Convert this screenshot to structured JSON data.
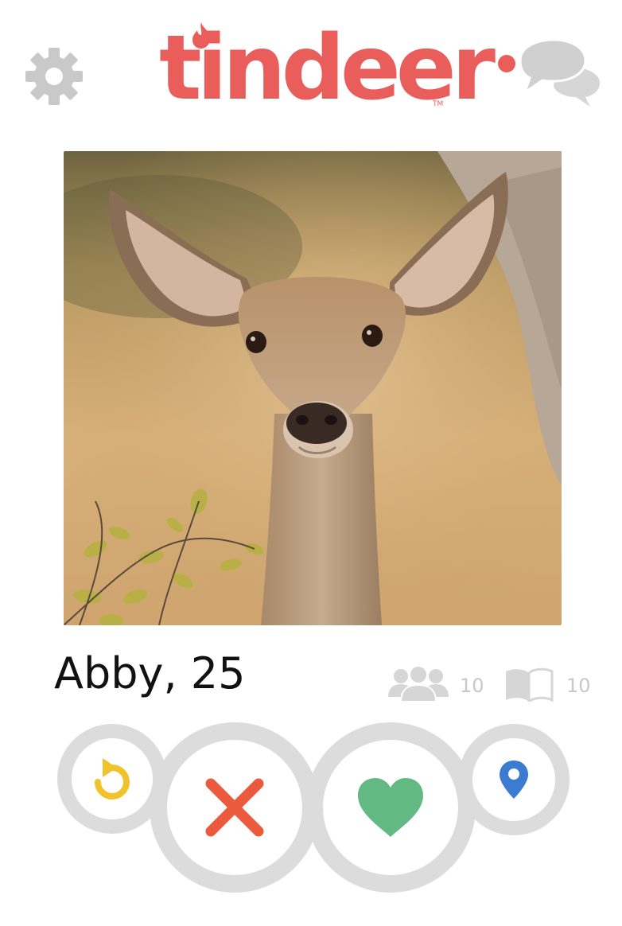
{
  "header": {
    "logo_text": "tindeer",
    "logo_tm": "TM",
    "settings_icon": "gear-icon",
    "messages_icon": "chat-bubbles-icon",
    "messages_badge_color": "#e95e5b"
  },
  "card": {
    "photo_subject": "deer-photo",
    "name_age": "Abby, 25",
    "friends_count": "10",
    "interests_count": "10"
  },
  "actions": {
    "rewind_icon": "rewind-icon",
    "nope_icon": "x-icon",
    "like_icon": "heart-icon",
    "location_icon": "location-pin-icon"
  },
  "colors": {
    "brand": "#e95e5b",
    "rewind": "#f2c22a",
    "nope": "#ec5a3e",
    "like": "#62ba82",
    "location": "#3b7bd0",
    "ring": "#dcdcdc",
    "icon_grey": "#c9c9c9"
  }
}
